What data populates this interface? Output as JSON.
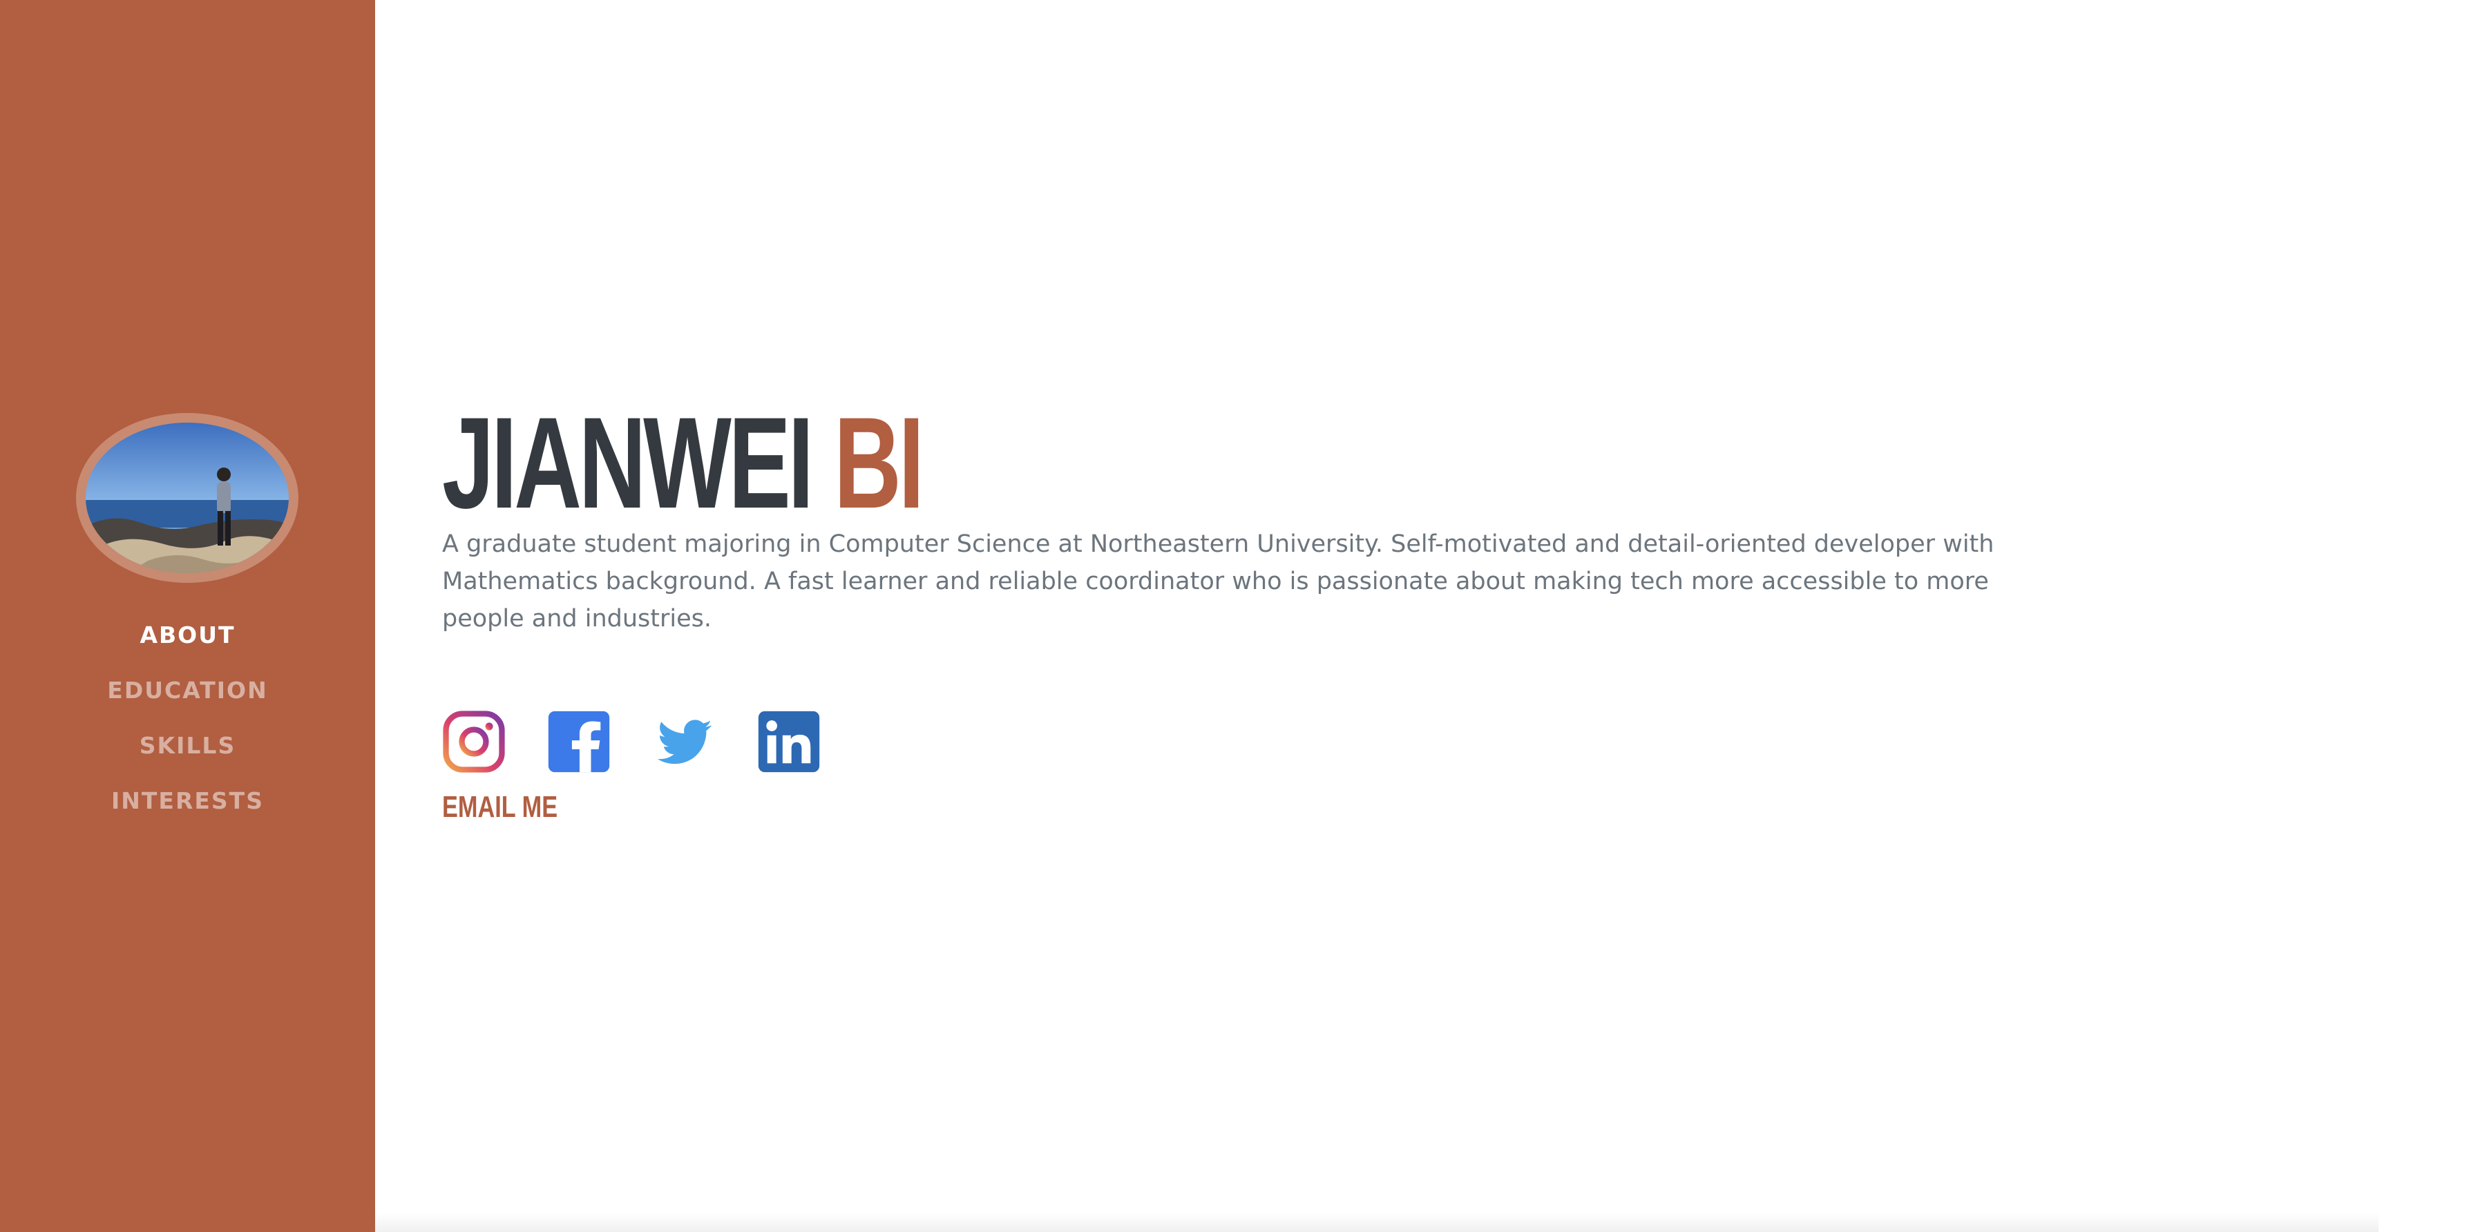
{
  "profile": {
    "first_name": "JIANWEI",
    "last_name": "BI",
    "bio": "A graduate student majoring in Computer Science at Northeastern University. Self-motivated and detail-oriented developer with Mathematics background. A fast learner and reliable coordinator who is passionate about making tech more accessible to more people and industries.",
    "email_label": "EMAIL ME"
  },
  "nav": {
    "items": [
      {
        "label": "ABOUT",
        "active": true
      },
      {
        "label": "EDUCATION",
        "active": false
      },
      {
        "label": "SKILLS",
        "active": false
      },
      {
        "label": "INTERESTS",
        "active": false
      }
    ]
  },
  "social": {
    "icons": [
      "instagram-icon",
      "facebook-icon",
      "twitter-icon",
      "linkedin-icon"
    ]
  },
  "colors": {
    "sidebar": "#b15e41",
    "accent": "#b15e41",
    "heading": "#343a40",
    "body_text": "#6c757d",
    "facebook": "#3b7ae8",
    "twitter": "#48a3ea",
    "linkedin": "#2d68b3"
  }
}
